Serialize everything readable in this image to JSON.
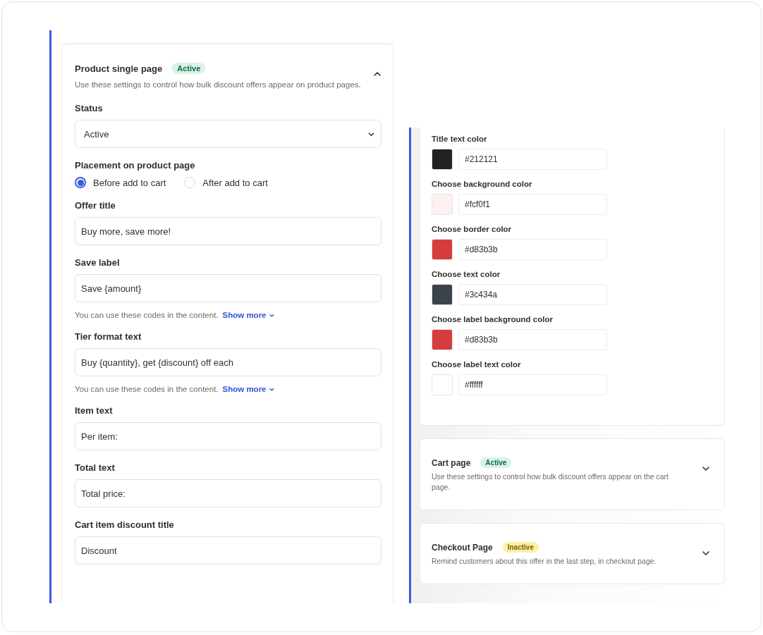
{
  "product_section": {
    "title": "Product single page",
    "badge": "Active",
    "active": true,
    "expanded": true,
    "description": "Use these settings to control how bulk discount offers appear on product pages.",
    "fields": [
      {
        "kind": "select",
        "label": "Status",
        "value": "Active"
      },
      {
        "kind": "radio",
        "label": "Placement on product page",
        "options": [
          {
            "label": "Before add to cart",
            "selected": true
          },
          {
            "label": "After add to cart",
            "selected": false
          }
        ]
      },
      {
        "kind": "text",
        "label": "Offer title",
        "value": "Buy more, save more!"
      },
      {
        "kind": "text",
        "label": "Save label",
        "value": "Save {amount}",
        "help": "You can use these codes in the content.",
        "link": "Show more"
      },
      {
        "kind": "text",
        "label": "Tier format text",
        "value": "Buy {quantity}, get {discount} off each",
        "help": "You can use these codes in the content.",
        "link": "Show more"
      },
      {
        "kind": "text",
        "label": "Item text",
        "value": "Per item:"
      },
      {
        "kind": "text",
        "label": "Total text",
        "value": "Total price:"
      },
      {
        "kind": "text",
        "label": "Cart item discount title",
        "value": "Discount"
      }
    ]
  },
  "color_settings": [
    {
      "label": "Title text color",
      "color": "#212121",
      "value": "#212121"
    },
    {
      "label": "Choose background color",
      "color": "#fcf0f1",
      "value": "#fcf0f1"
    },
    {
      "label": "Choose border color",
      "color": "#d83b3b",
      "value": "#d83b3b"
    },
    {
      "label": "Choose text color",
      "color": "#3c434a",
      "value": "#3c434a"
    },
    {
      "label": "Choose label background color",
      "color": "#d83b3b",
      "value": "#d83b3b"
    },
    {
      "label": "Choose label text color",
      "color": "#ffffff",
      "value": "#ffffff"
    }
  ],
  "other_sections": [
    {
      "title": "Cart page",
      "badge": "Active",
      "active": true,
      "expanded": false,
      "description": "Use these settings to control how bulk discount offers appear on the cart page."
    },
    {
      "title": "Checkout Page",
      "badge": "Inactive",
      "active": false,
      "expanded": false,
      "description": "Remind customers about this offer in the last step, in checkout page."
    }
  ]
}
